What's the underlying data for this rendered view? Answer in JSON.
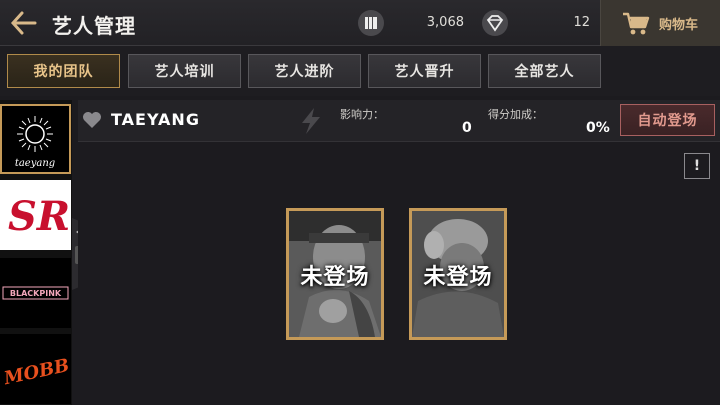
{
  "header": {
    "title": "艺人管理",
    "resources": [
      {
        "icon": "album-icon",
        "value": "3,068"
      },
      {
        "icon": "diamond-icon",
        "value": "12"
      }
    ],
    "cart_label": "购物车"
  },
  "tabs": [
    {
      "label": "我的团队",
      "active": true
    },
    {
      "label": "艺人培训",
      "active": false
    },
    {
      "label": "艺人进阶",
      "active": false
    },
    {
      "label": "艺人晋升",
      "active": false
    },
    {
      "label": "全部艺人",
      "active": false
    }
  ],
  "artist_list": [
    {
      "logo_text": "TAEYANG",
      "selected": true
    },
    {
      "logo_text": "SR"
    },
    {
      "logo_text": "BLACKPINK"
    },
    {
      "logo_text": "MOBB"
    }
  ],
  "artist_info": {
    "name": "TAEYANG",
    "influence_label": "影响力：",
    "influence_value": "0",
    "bonus_label": "得分加成：",
    "bonus_value": "0%",
    "auto_button": "自动登场",
    "help": "!"
  },
  "slots": [
    {
      "status": "未登场"
    },
    {
      "status": "未登场"
    }
  ],
  "colors": {
    "accent": "#c59a58",
    "auto_btn": "#e29a8e"
  }
}
